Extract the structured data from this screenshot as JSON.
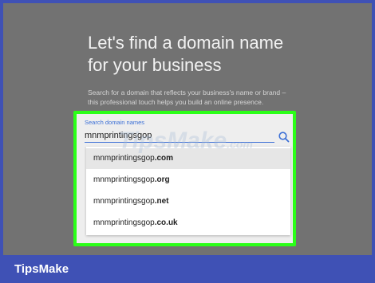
{
  "page": {
    "heading_line1": "Let's find a domain name",
    "heading_line2": "for your business",
    "description_line1": "Search for a domain that reflects your business's name or brand –",
    "description_line2": "this professional touch helps you build an online presence."
  },
  "search": {
    "label": "Search domain names",
    "value": "mnmprintingsgop",
    "icon": "search-icon"
  },
  "suggestions": [
    {
      "base": "mnmprintingsgop",
      "tld": ".com"
    },
    {
      "base": "mnmprintingsgop",
      "tld": ".org"
    },
    {
      "base": "mnmprintingsgop",
      "tld": ".net"
    },
    {
      "base": "mnmprintingsgop",
      "tld": ".co.uk"
    }
  ],
  "watermark": {
    "text": "TipsMake",
    "suffix": ".com"
  },
  "footer": {
    "brand": "TipsMake"
  },
  "colors": {
    "accent": "#3b6fd6",
    "highlight": "#2bff18",
    "footer": "#3f51b5",
    "overlay": "#727272"
  }
}
